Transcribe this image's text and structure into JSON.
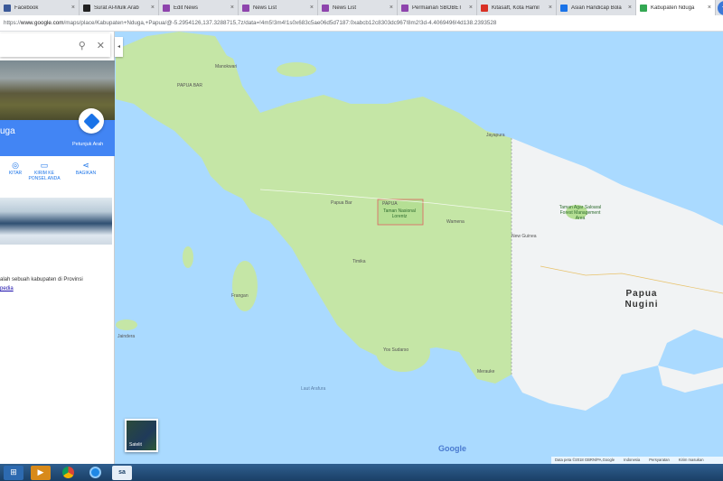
{
  "browser": {
    "tabs": [
      {
        "label": "Facebook",
        "color": "#3b5998"
      },
      {
        "label": "Surat Al-Mulk Arab",
        "color": "#222222"
      },
      {
        "label": "Edit News",
        "color": "#8e44ad"
      },
      {
        "label": "News List",
        "color": "#8e44ad"
      },
      {
        "label": "News List",
        "color": "#8e44ad"
      },
      {
        "label": "Permainan SBOBET",
        "color": "#8e44ad"
      },
      {
        "label": "Kitasaft, Kota Hamil",
        "color": "#d93025"
      },
      {
        "label": "Asian Handicap Bola",
        "color": "#1a73e8"
      },
      {
        "label": "Kabupaten Nduga",
        "color": "#34a853"
      }
    ],
    "tab_close": "×",
    "new_tab": "+",
    "url_prefix": "https://",
    "url_host": "www.google.com",
    "url_rest": "/maps/place/Kabupaten+Nduga,+Papua/@-5.2954126,137.3288715,7z/data=!4m5!3m4!1s0x683c5ae06d5d7187:0xabcb12c8303dc967!8m2!3d-4.4069496!4d138.2393528"
  },
  "panel": {
    "search_icon": "search-icon",
    "place_name": "uga",
    "directions_label": "Petunjuk Arah",
    "actions": [
      {
        "label": "KITAR",
        "icon": "nearby-icon"
      },
      {
        "label": "KIRIM KE PONSEL ANDA",
        "icon": "send-to-phone-icon"
      },
      {
        "label": "BAGIKAN",
        "icon": "share-icon"
      }
    ],
    "description": "alah sebuah kabupaten di Provinsi",
    "wiki_link": "pedia"
  },
  "map": {
    "labels": [
      {
        "text": "Manokwari"
      },
      {
        "text": "PAPUA BAR"
      },
      {
        "text": "Jayapura"
      },
      {
        "text": "Papua Bar"
      },
      {
        "text": "Timika"
      },
      {
        "text": "Wamena"
      },
      {
        "text": "Merauke"
      },
      {
        "text": "Yos Sudarso"
      },
      {
        "text": "Frangan"
      },
      {
        "text": "Jaindera"
      },
      {
        "text": "New Guinea"
      },
      {
        "text": "PAPUA"
      }
    ],
    "sea_labels": [
      {
        "text": "Laut Arafura"
      }
    ],
    "park_national": "Taman Nasional Lorentz",
    "park_png": "Taman Agar Saloaral Forest Management Area",
    "country_png": "Papua Nugini",
    "satellite_label": "Satelit",
    "google_logo": "Google",
    "footer": {
      "data": "Data peta ©2018 GBRN/PA,Google",
      "country": "Indonesia",
      "terms": "Persyaratan",
      "feedback": "Kirim masukan"
    },
    "colors": {
      "sea": "#aadaff",
      "land_idn": "#c5e6a6",
      "land_png": "#f1f3f4"
    }
  },
  "taskbar": {
    "items": [
      {
        "icon": "windows-start-icon"
      },
      {
        "icon": "media-player-icon"
      },
      {
        "icon": "chrome-icon"
      },
      {
        "icon": "browser-icon"
      },
      {
        "icon": "app-sa-icon",
        "label": "sa"
      }
    ]
  }
}
